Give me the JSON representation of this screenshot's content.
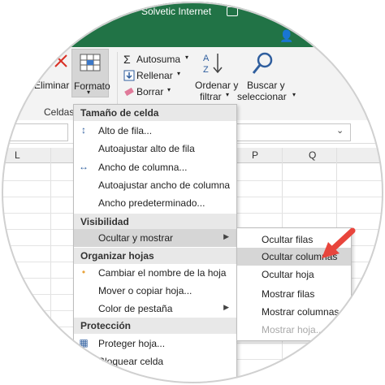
{
  "title_bar": {
    "app_title": "Solvetic Internet",
    "color": "#217346"
  },
  "ribbon": {
    "eliminar_label": "Eliminar",
    "formato_label": "Formato",
    "celdas_label": "Celdas",
    "autosuma_label": "Autosuma",
    "rellenar_label": "Rellenar",
    "borrar_label": "Borrar",
    "ordenar_line1": "Ordenar y",
    "ordenar_line2": "filtrar",
    "buscar_line1": "Buscar y",
    "buscar_line2": "seleccionar"
  },
  "grid": {
    "col_l": "L",
    "col_p": "P",
    "col_q": "Q"
  },
  "menu": {
    "sections": {
      "tamano": "Tamaño de celda",
      "visibilidad": "Visibilidad",
      "organizar": "Organizar hojas",
      "proteccion": "Protección"
    },
    "items": {
      "alto_fila": "Alto de fila...",
      "autoajustar_alto": "Autoajustar alto de fila",
      "ancho_columna": "Ancho de columna...",
      "autoajustar_ancho": "Autoajustar ancho de columna",
      "ancho_predeterminado": "Ancho predeterminado...",
      "ocultar_mostrar": "Ocultar y mostrar",
      "cambiar_nombre": "Cambiar el nombre de la hoja",
      "mover_copiar": "Mover o copiar hoja...",
      "color_pestana": "Color de pestaña",
      "proteger_hoja": "Proteger hoja...",
      "bloquear_celda": "Bloquear celda"
    }
  },
  "submenu": {
    "items": {
      "ocultar_filas": "Ocultar filas",
      "ocultar_columnas": "Ocultar columnas",
      "ocultar_hoja": "Ocultar hoja",
      "mostrar_filas": "Mostrar filas",
      "mostrar_columnas": "Mostrar columnas",
      "mostrar_hoja": "Mostrar hoja..."
    }
  },
  "accent": {
    "pointer_color": "#e8453c",
    "highlight_color": "#d6d6d6"
  }
}
